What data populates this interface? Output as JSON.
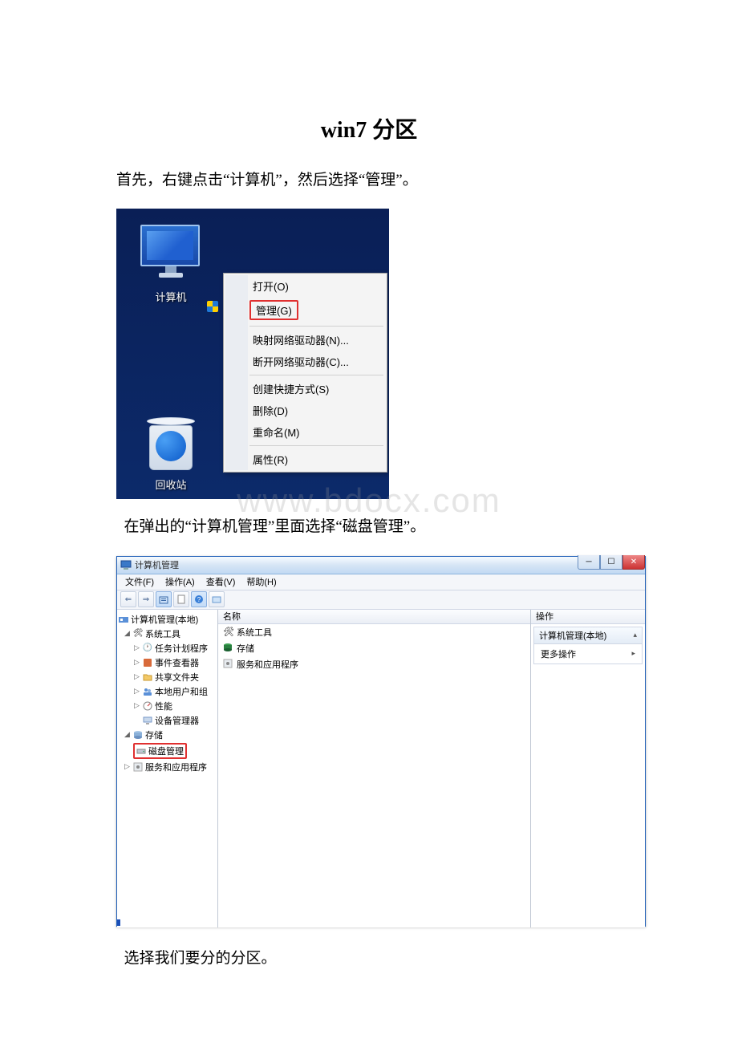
{
  "title": "win7 分区",
  "paragraphs": {
    "p1": "首先，右键点击“计算机”，然后选择“管理”。",
    "p2": "在弹出的“计算机管理”里面选择“磁盘管理”。",
    "p3": "选择我们要分的分区。"
  },
  "watermark": "www.bdocx.com",
  "shot1": {
    "computer_label": "计算机",
    "recycle_label": "回收站",
    "menu": {
      "open": "打开(O)",
      "manage": "管理(G)",
      "map_drive": "映射网络驱动器(N)...",
      "disconnect_drive": "断开网络驱动器(C)...",
      "create_shortcut": "创建快捷方式(S)",
      "delete": "删除(D)",
      "rename": "重命名(M)",
      "properties": "属性(R)"
    }
  },
  "shot2": {
    "window_title": "计算机管理",
    "menu": {
      "file": "文件(F)",
      "action": "操作(A)",
      "view": "查看(V)",
      "help": "帮助(H)"
    },
    "tree": {
      "root": "计算机管理(本地)",
      "system_tools": "系统工具",
      "task_scheduler": "任务计划程序",
      "event_viewer": "事件查看器",
      "shared_folders": "共享文件夹",
      "local_users": "本地用户和组",
      "performance": "性能",
      "device_manager": "设备管理器",
      "storage": "存储",
      "disk_mgmt": "磁盘管理",
      "services": "服务和应用程序"
    },
    "mid": {
      "header": "名称",
      "item1": "系统工具",
      "item2": "存储",
      "item3": "服务和应用程序"
    },
    "right": {
      "header": "操作",
      "section_title": "计算机管理(本地)",
      "more": "更多操作"
    }
  }
}
